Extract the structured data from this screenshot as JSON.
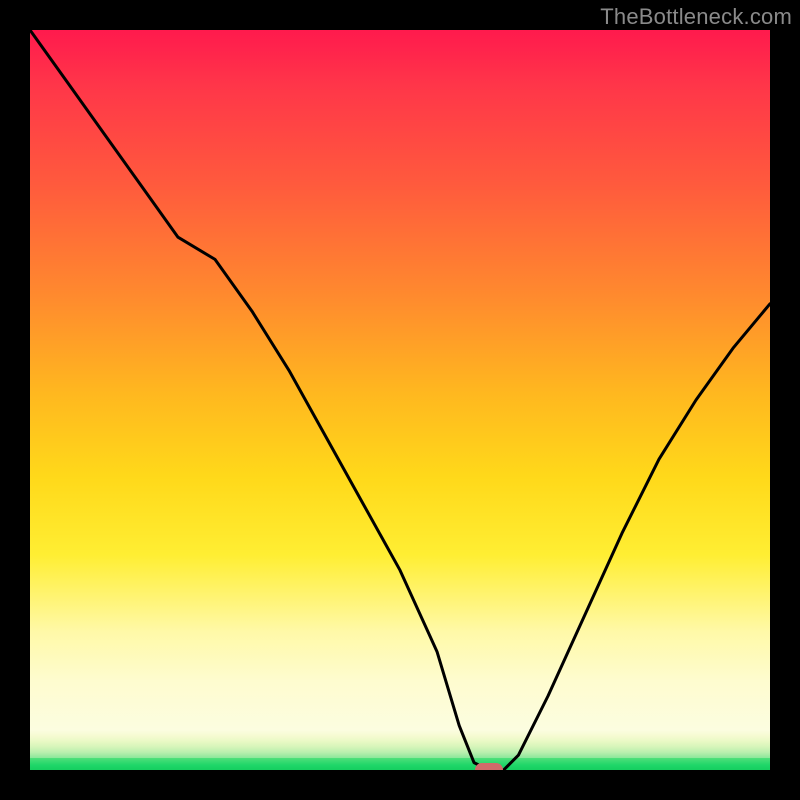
{
  "watermark": "TheBottleneck.com",
  "marker": {
    "x_pct": 62,
    "y_pct": 100
  },
  "chart_data": {
    "type": "line",
    "title": "",
    "xlabel": "",
    "ylabel": "",
    "xlim": [
      0,
      100
    ],
    "ylim": [
      0,
      100
    ],
    "grid": false,
    "legend": false,
    "series": [
      {
        "name": "curve",
        "x": [
          0,
          5,
          10,
          15,
          20,
          25,
          30,
          35,
          40,
          45,
          50,
          55,
          58,
          60,
          62,
          64,
          66,
          70,
          75,
          80,
          85,
          90,
          95,
          100
        ],
        "y": [
          100,
          93,
          86,
          79,
          72,
          69,
          62,
          54,
          45,
          36,
          27,
          16,
          6,
          1,
          0,
          0,
          2,
          10,
          21,
          32,
          42,
          50,
          57,
          63
        ]
      }
    ],
    "background_gradient": {
      "direction": "vertical",
      "stops": [
        {
          "pct": 0,
          "color": "#ff1a4d"
        },
        {
          "pct": 25,
          "color": "#ff7a33"
        },
        {
          "pct": 55,
          "color": "#ffd51a"
        },
        {
          "pct": 82,
          "color": "#fdf7b0"
        },
        {
          "pct": 96,
          "color": "#8be79a"
        },
        {
          "pct": 100,
          "color": "#16cf60"
        }
      ]
    },
    "markers": [
      {
        "name": "bottleneck-point",
        "x": 62,
        "y": 0,
        "color": "#d06a6a",
        "shape": "pill"
      }
    ]
  }
}
